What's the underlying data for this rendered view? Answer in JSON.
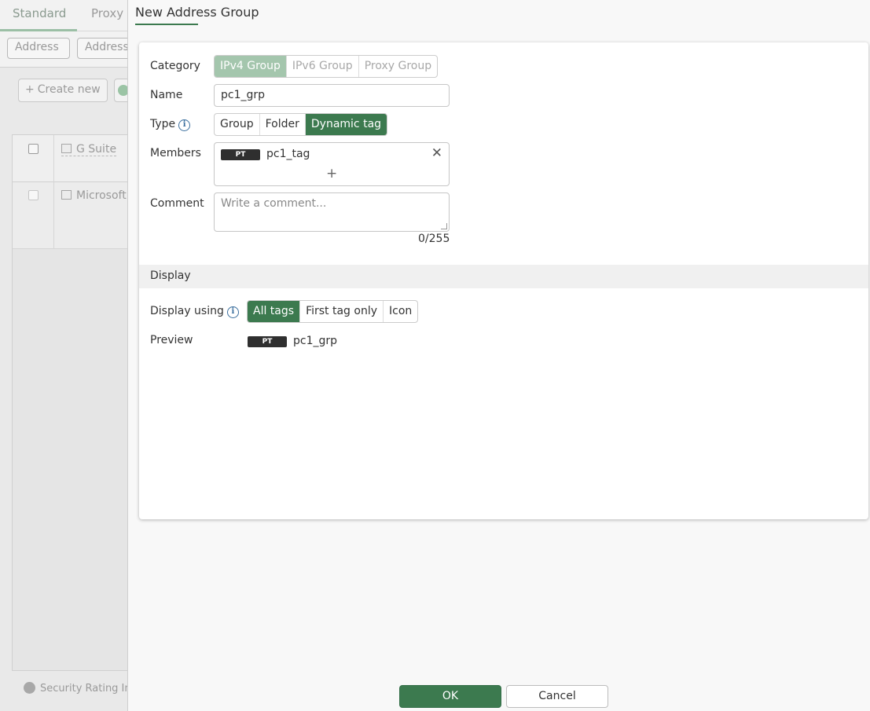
{
  "background": {
    "tabs": [
      "Standard",
      "Proxy"
    ],
    "filters": [
      "Address",
      "Address"
    ],
    "create_new_label": "Create new",
    "rows": [
      "G Suite",
      "Microsoft"
    ],
    "footer_text": "Security Rating Ins"
  },
  "dialog": {
    "title": "New Address Group",
    "category": {
      "label": "Category",
      "options": [
        "IPv4 Group",
        "IPv6 Group",
        "Proxy Group"
      ],
      "selected": "IPv4 Group"
    },
    "name": {
      "label": "Name",
      "value": "pc1_grp"
    },
    "type": {
      "label": "Type",
      "options": [
        "Group",
        "Folder",
        "Dynamic tag"
      ],
      "selected": "Dynamic tag"
    },
    "members": {
      "label": "Members",
      "items": [
        {
          "tag": "PT",
          "name": "pc1_tag"
        }
      ]
    },
    "comment": {
      "label": "Comment",
      "placeholder": "Write a comment...",
      "counter": "0/255"
    },
    "display_section": {
      "title": "Display"
    },
    "display_using": {
      "label": "Display using",
      "options": [
        "All tags",
        "First tag only",
        "Icon"
      ],
      "selected": "All tags"
    },
    "preview": {
      "label": "Preview",
      "tag": "PT",
      "name": "pc1_grp"
    }
  },
  "footer": {
    "ok_label": "OK",
    "cancel_label": "Cancel"
  },
  "colors": {
    "accent": "#3c7a4f",
    "accent_disabled": "#a4c6ad",
    "tag_chip": "#2f2f2f"
  }
}
